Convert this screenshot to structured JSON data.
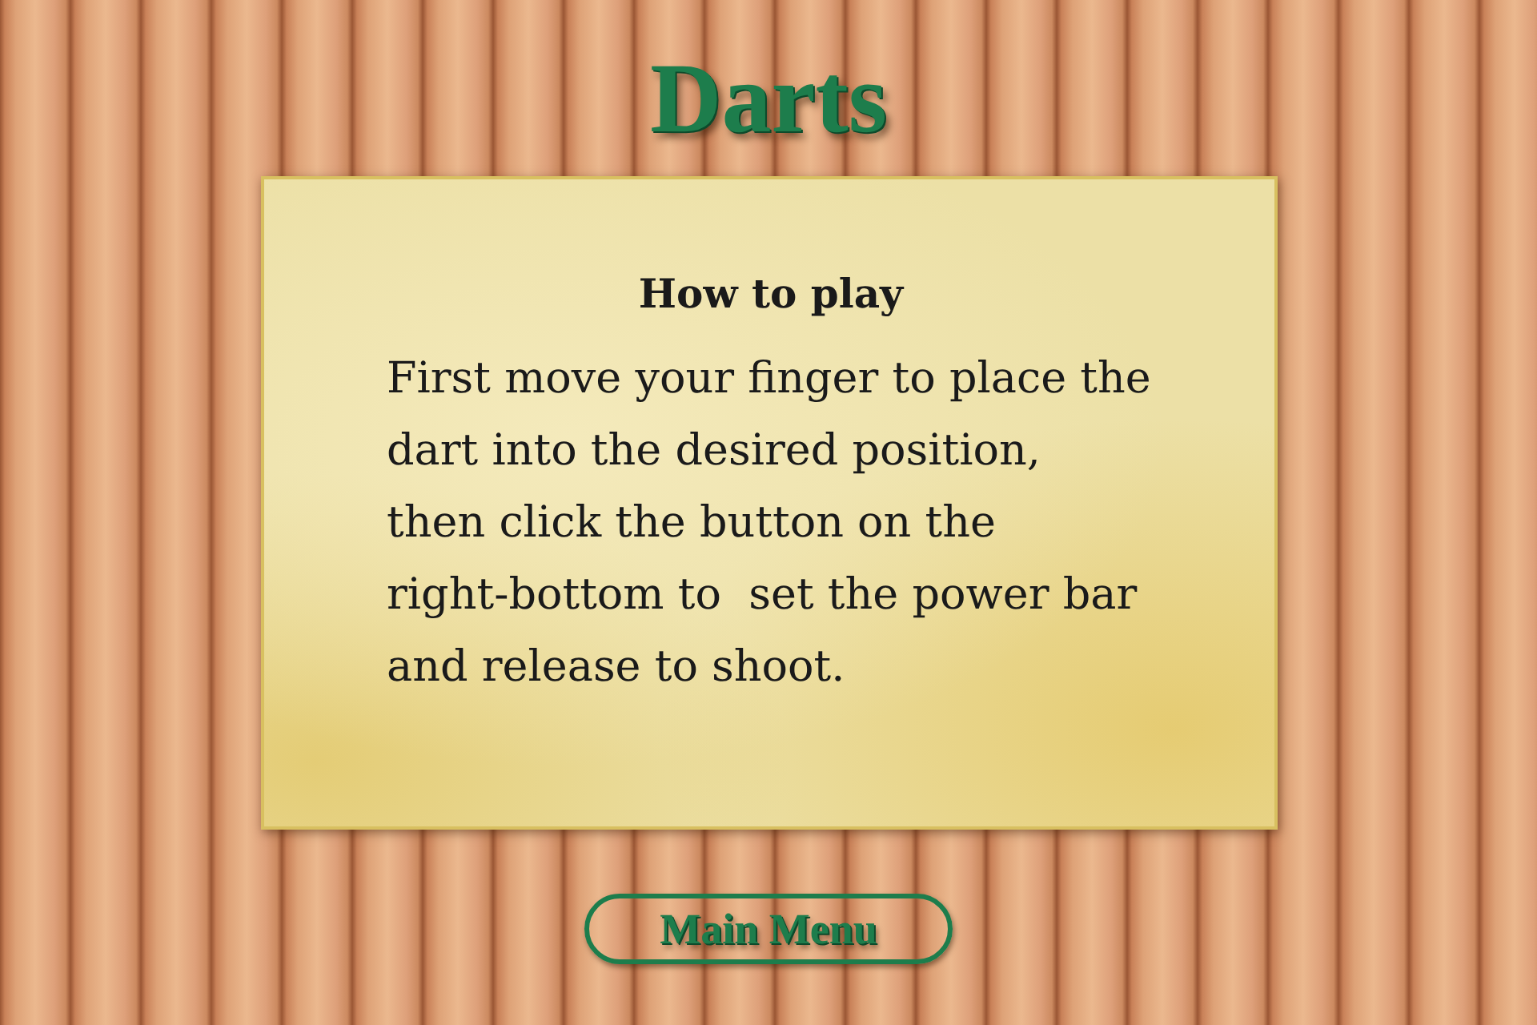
{
  "title": "Darts",
  "card": {
    "heading": "How to play",
    "text": "First move your finger to place the\ndart into the desired position,\nthen click the button on the\nright-bottom to  set the power bar\nand release to shoot."
  },
  "main_menu_button": {
    "label": "Main Menu"
  }
}
